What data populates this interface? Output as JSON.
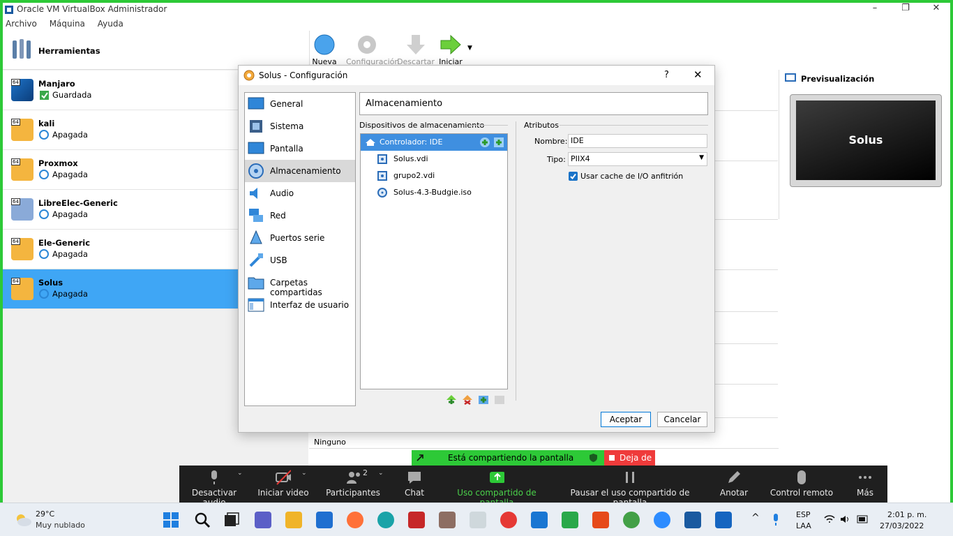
{
  "window": {
    "title": "Oracle VM VirtualBox Administrador"
  },
  "menu": [
    "Archivo",
    "Máquina",
    "Ayuda"
  ],
  "tools_label": "Herramientas",
  "vms": [
    {
      "name": "Manjaro",
      "state": "Guardada",
      "badge": "64"
    },
    {
      "name": "kali",
      "state": "Apagada",
      "badge": "64"
    },
    {
      "name": "Proxmox",
      "state": "Apagada",
      "badge": "64"
    },
    {
      "name": "LibreElec-Generic",
      "state": "Apagada",
      "badge": "64"
    },
    {
      "name": "Ele-Generic",
      "state": "Apagada",
      "badge": "64"
    },
    {
      "name": "Solus",
      "state": "Apagada",
      "badge": "64"
    }
  ],
  "toolbar": {
    "nueva": "Nueva",
    "configuracion": "Configuración",
    "descartar": "Descartar",
    "iniciar": "Iniciar"
  },
  "preview": {
    "title": "Previsualización",
    "screen_text": "Solus"
  },
  "ninguno": "Ninguno",
  "dialog": {
    "title": "Solus - Configuración",
    "help": "?",
    "nav": [
      "General",
      "Sistema",
      "Pantalla",
      "Almacenamiento",
      "Audio",
      "Red",
      "Puertos serie",
      "USB",
      "Carpetas compartidas",
      "Interfaz de usuario"
    ],
    "section_title": "Almacenamiento",
    "devices_label": "Dispositivos de almacenamiento",
    "controller": "Controlador: IDE",
    "devices": [
      "Solus.vdi",
      "grupo2.vdi",
      "Solus-4.3-Budgie.iso"
    ],
    "attributes_label": "Atributos",
    "name_label": "Nombre:",
    "name_value": "IDE",
    "type_label": "Tipo:",
    "type_value": "PIIX4",
    "cache_label": "Usar cache de I/O anfitrión",
    "ok": "Aceptar",
    "cancel": "Cancelar"
  },
  "share": {
    "banner": "Está compartiendo la pantalla",
    "stop": "Deja de"
  },
  "zoom": {
    "mute": "Desactivar audio",
    "video": "Iniciar video",
    "participants": "Participantes",
    "participants_count": "2",
    "chat": "Chat",
    "share": "Uso compartido de pantalla",
    "pause": "Pausar el uso compartido de pantalla",
    "annotate": "Anotar",
    "remote": "Control remoto",
    "more": "Más"
  },
  "taskbar": {
    "weather_temp": "29°C",
    "weather_desc": "Muy nublado",
    "lang1": "ESP",
    "lang2": "LAA",
    "time": "2:01 p. m.",
    "date": "27/03/2022"
  },
  "colors": {
    "accent": "#3fa6f5",
    "share_green": "#2dc937",
    "stop_red": "#ef3b3b",
    "zoom_bg": "#1f1f1f"
  }
}
